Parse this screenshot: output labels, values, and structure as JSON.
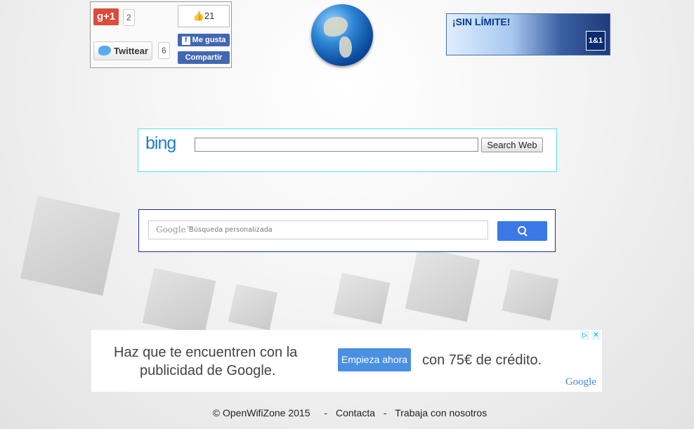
{
  "social": {
    "gplus_label": "g+1",
    "gplus_count": "2",
    "tweet_label": "Twittear",
    "tweet_count": "6",
    "fb_count": "21",
    "fb_like_label": "Me gusta",
    "fb_share_label": "Compartir"
  },
  "banner": {
    "text": "¡SIN LÍMITE!",
    "logo": "1&1"
  },
  "bing": {
    "logo": "bing",
    "button_label": "Search Web",
    "input_value": ""
  },
  "google_search": {
    "logo_text": "Google™",
    "placeholder": "Búsqueda personalizada"
  },
  "ad": {
    "line1": "Haz que te encuentren con la",
    "line2": "publicidad de Google.",
    "cta": "Empieza ahora",
    "credit": "con 75€ de crédito.",
    "brand": "Google",
    "adchoices_icon": "▷",
    "close_icon": "✕"
  },
  "footer": {
    "copyright": "© OpenWifiZone 2015",
    "separator": "-",
    "link_contact": "Contacta",
    "link_jobs": "Trabaja con nosotros"
  }
}
